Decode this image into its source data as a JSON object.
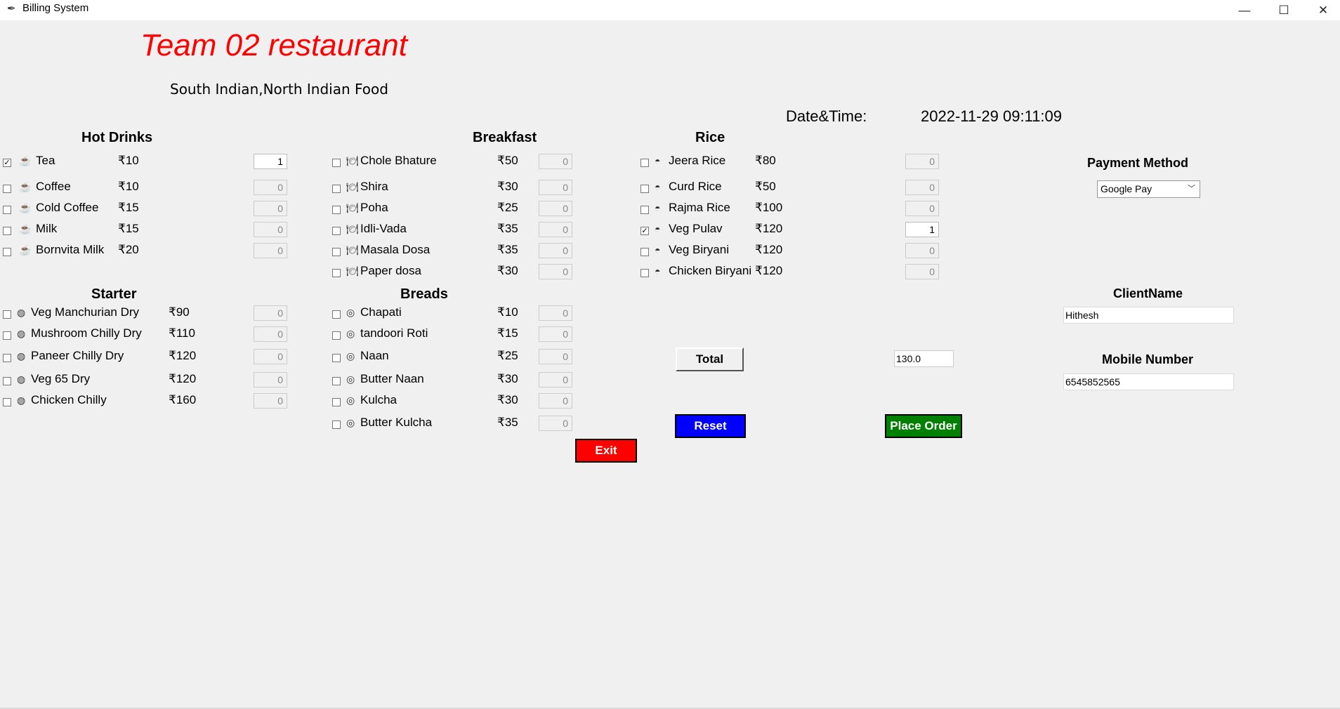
{
  "window": {
    "title": "Billing System",
    "controls": {
      "minimize": "—",
      "maximize": "☐",
      "close": "✕"
    }
  },
  "header": {
    "restaurant_name": "Team 02 restaurant",
    "cuisine": "South Indian,North Indian Food",
    "datetime_label": "Date&Time:",
    "datetime_value": "2022-11-29 09:11:09"
  },
  "sections": {
    "hot_drinks": {
      "title": "Hot Drinks",
      "items": [
        {
          "name": "Tea",
          "price": "₹10",
          "qty": "1",
          "checked": true
        },
        {
          "name": "Coffee",
          "price": "₹10",
          "qty": "0",
          "checked": false
        },
        {
          "name": "Cold Coffee",
          "price": "₹15",
          "qty": "0",
          "checked": false
        },
        {
          "name": "Milk",
          "price": "₹15",
          "qty": "0",
          "checked": false
        },
        {
          "name": "Bornvita Milk",
          "price": "₹20",
          "qty": "0",
          "checked": false
        }
      ]
    },
    "breakfast": {
      "title": "Breakfast",
      "items": [
        {
          "name": "Chole Bhature",
          "price": "₹50",
          "qty": "0",
          "checked": false
        },
        {
          "name": "Shira",
          "price": "₹30",
          "qty": "0",
          "checked": false
        },
        {
          "name": "Poha",
          "price": "₹25",
          "qty": "0",
          "checked": false
        },
        {
          "name": "Idli-Vada",
          "price": "₹35",
          "qty": "0",
          "checked": false
        },
        {
          "name": "Masala Dosa",
          "price": "₹35",
          "qty": "0",
          "checked": false
        },
        {
          "name": "Paper dosa",
          "price": "₹30",
          "qty": "0",
          "checked": false
        }
      ]
    },
    "rice": {
      "title": "Rice",
      "items": [
        {
          "name": "Jeera Rice",
          "price": "₹80",
          "qty": "0",
          "checked": false
        },
        {
          "name": "Curd Rice",
          "price": "₹50",
          "qty": "0",
          "checked": false
        },
        {
          "name": "Rajma Rice",
          "price": "₹100",
          "qty": "0",
          "checked": false
        },
        {
          "name": "Veg Pulav",
          "price": "₹120",
          "qty": "1",
          "checked": true
        },
        {
          "name": "Veg Biryani",
          "price": "₹120",
          "qty": "0",
          "checked": false
        },
        {
          "name": "Chicken Biryani",
          "price": "₹120",
          "qty": "0",
          "checked": false
        }
      ]
    },
    "starter": {
      "title": "Starter",
      "items": [
        {
          "name": "Veg Manchurian Dry",
          "price": "₹90",
          "qty": "0",
          "checked": false
        },
        {
          "name": "Mushroom Chilly Dry",
          "price": "₹110",
          "qty": "0",
          "checked": false
        },
        {
          "name": "Paneer Chilly Dry",
          "price": "₹120",
          "qty": "0",
          "checked": false
        },
        {
          "name": "Veg 65 Dry",
          "price": "₹120",
          "qty": "0",
          "checked": false
        },
        {
          "name": "Chicken Chilly",
          "price": "₹160",
          "qty": "0",
          "checked": false
        }
      ]
    },
    "breads": {
      "title": "Breads",
      "items": [
        {
          "name": "Chapati",
          "price": "₹10",
          "qty": "0",
          "checked": false
        },
        {
          "name": "tandoori Roti",
          "price": "₹15",
          "qty": "0",
          "checked": false
        },
        {
          "name": "Naan",
          "price": "₹25",
          "qty": "0",
          "checked": false
        },
        {
          "name": "Butter Naan",
          "price": "₹30",
          "qty": "0",
          "checked": false
        },
        {
          "name": "Kulcha",
          "price": "₹30",
          "qty": "0",
          "checked": false
        },
        {
          "name": "Butter Kulcha",
          "price": "₹35",
          "qty": "0",
          "checked": false
        }
      ]
    }
  },
  "icons": {
    "hot_drinks": "cup-icon",
    "breakfast": "plate-icon",
    "rice": "bowl-icon",
    "starter": "dish-icon",
    "breads": "bread-icon"
  },
  "total": {
    "button_label": "Total",
    "value": "130.0"
  },
  "actions": {
    "reset_label": "Reset",
    "place_order_label": "Place Order",
    "exit_label": "Exit"
  },
  "payment": {
    "title": "Payment Method",
    "selected": "Google Pay"
  },
  "client": {
    "name_label": "ClientName",
    "name_value": "Hithesh",
    "mobile_label": "Mobile Number",
    "mobile_value": "6545852565"
  },
  "colors": {
    "title_red": "#ff0000",
    "reset_blue": "#0000ff",
    "order_green": "#008000",
    "exit_red": "#ff0000"
  }
}
